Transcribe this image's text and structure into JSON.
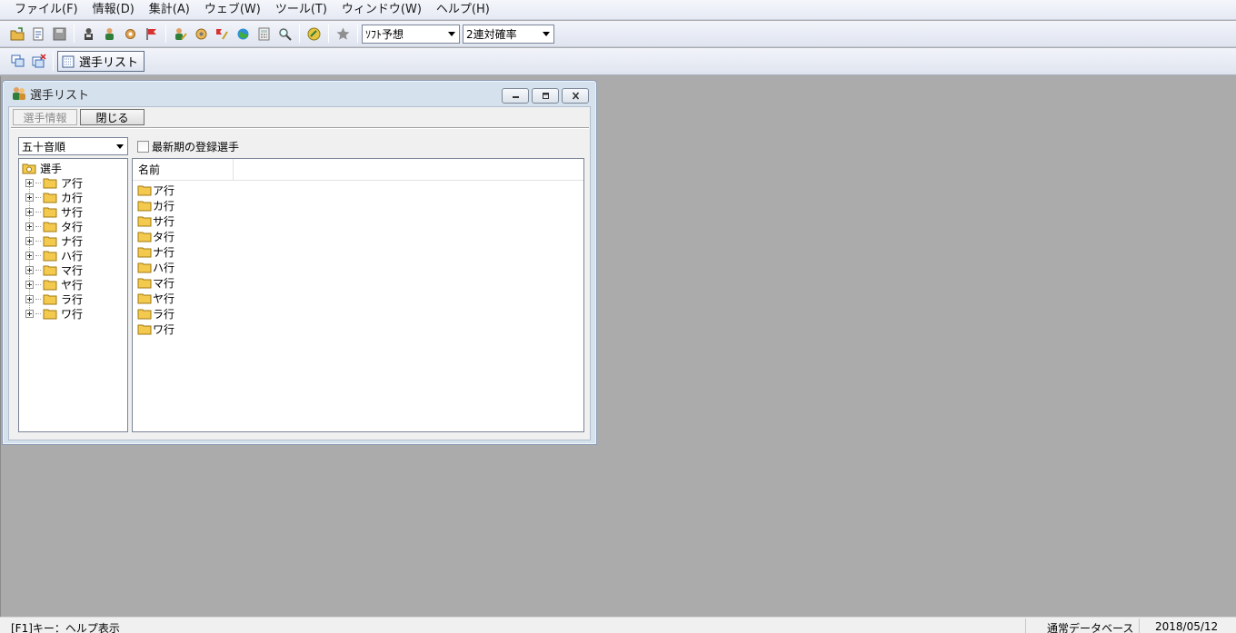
{
  "menubar": {
    "items": [
      "ファイル(F)",
      "情報(D)",
      "集計(A)",
      "ウェブ(W)",
      "ツール(T)",
      "ウィンドウ(W)",
      "ヘルプ(H)"
    ]
  },
  "toolbar": {
    "icons": [
      "open-folder-icon",
      "document-icon",
      "save-icon",
      "racers-icon",
      "racer-icon",
      "gear-icon",
      "red-flag-icon",
      "edit-racer-icon",
      "settings-icon",
      "flags-icon",
      "globe-icon",
      "calculator-icon",
      "magnifier-icon",
      "web-icon",
      "star-icon"
    ],
    "predict_select": "ｿﾌﾄ予想",
    "probability_select": "2連対確率"
  },
  "window_bar": {
    "tab_label": "選手リスト"
  },
  "child_window": {
    "title": "選手リスト",
    "info_button": "選手情報",
    "close_button": "閉じる",
    "sort_select": "五十音順",
    "latest_checkbox_label": "最新期の登録選手",
    "latest_checkbox_checked": false,
    "tree": {
      "root": "選手",
      "items": [
        "ア行",
        "カ行",
        "サ行",
        "タ行",
        "ナ行",
        "ハ行",
        "マ行",
        "ヤ行",
        "ラ行",
        "ワ行"
      ]
    },
    "list": {
      "column_name": "名前",
      "rows": [
        "ア行",
        "カ行",
        "サ行",
        "タ行",
        "ナ行",
        "ハ行",
        "マ行",
        "ヤ行",
        "ラ行",
        "ワ行"
      ]
    }
  },
  "statusbar": {
    "help": "[F1]キー：ヘルプ表示",
    "database": "通常データベース",
    "date": "2018/05/12"
  },
  "colors": {
    "mdi_background": "#ababab",
    "window_frame": "#d6e1ee",
    "folder_yellow": "#f3c94e"
  }
}
